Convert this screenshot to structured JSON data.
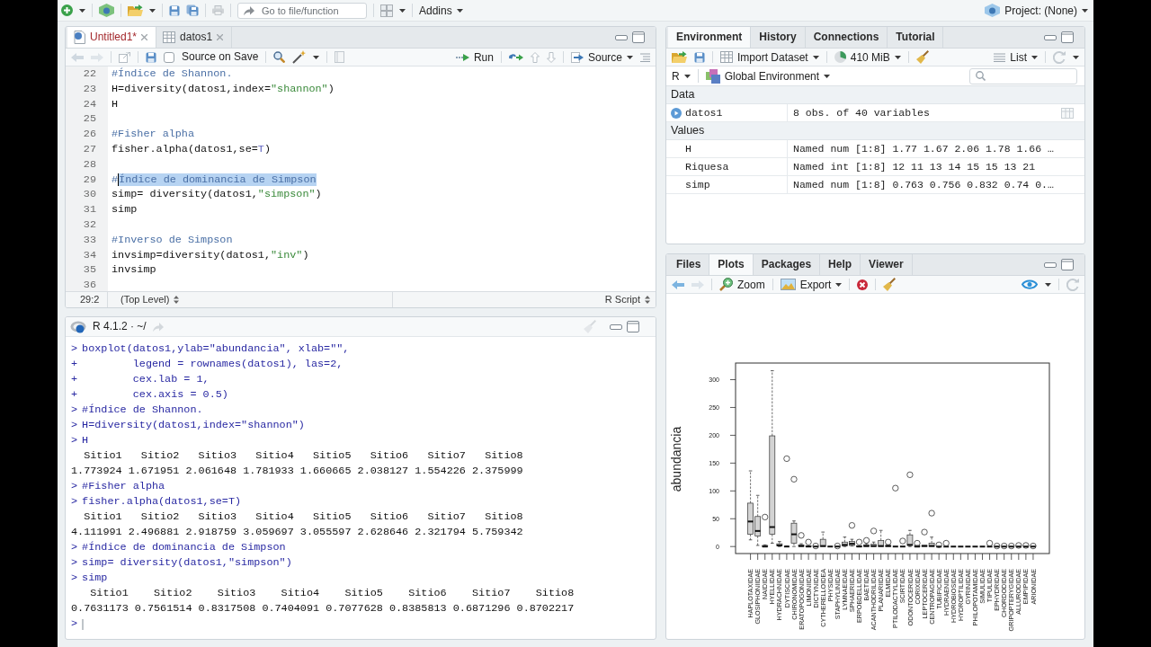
{
  "toolbar": {
    "go_to_placeholder": "Go to file/function",
    "addins": "Addins",
    "project": "Project: (None)"
  },
  "editor": {
    "tabs": [
      {
        "label": "Untitled1*",
        "kind": "script",
        "modified": true,
        "selected": true
      },
      {
        "label": "datos1",
        "kind": "data",
        "modified": false,
        "selected": false
      }
    ],
    "source_on_save": {
      "label": "Source on Save",
      "checked": false
    },
    "run": "Run",
    "source": "Source",
    "lines": [
      {
        "number": "22",
        "tokens": [
          {
            "kind": "comment",
            "text": "#Índice de Shannon.",
            "selected": false
          }
        ]
      },
      {
        "number": "23",
        "tokens": [
          {
            "kind": "code",
            "text": "H=diversity(datos1,index=",
            "selected": false
          },
          {
            "kind": "string",
            "text": "\"shannon\"",
            "selected": false
          },
          {
            "kind": "code",
            "text": ")",
            "selected": false
          }
        ]
      },
      {
        "number": "24",
        "tokens": [
          {
            "kind": "code",
            "text": "H",
            "selected": false
          }
        ]
      },
      {
        "number": "25"
      },
      {
        "number": "26",
        "tokens": [
          {
            "kind": "comment",
            "text": "#Fisher alpha",
            "selected": false
          }
        ]
      },
      {
        "number": "27",
        "tokens": [
          {
            "kind": "code",
            "text": "fisher.alpha(datos1,se=",
            "selected": false
          },
          {
            "kind": "constant",
            "text": "T",
            "selected": false
          },
          {
            "kind": "code",
            "text": ")",
            "selected": false
          }
        ]
      },
      {
        "number": "28"
      },
      {
        "number": "29",
        "tokens": [
          {
            "kind": "comment",
            "text": "#",
            "selected": false
          },
          {
            "kind": "comment",
            "text": "Índice de dominancia de Simpson",
            "selected": true
          }
        ]
      },
      {
        "number": "30",
        "tokens": [
          {
            "kind": "code",
            "text": "simp= diversity(datos1,",
            "selected": false
          },
          {
            "kind": "string",
            "text": "\"simpson\"",
            "selected": false
          },
          {
            "kind": "code",
            "text": ")",
            "selected": false
          }
        ]
      },
      {
        "number": "31",
        "tokens": [
          {
            "kind": "code",
            "text": "simp",
            "selected": false
          }
        ]
      },
      {
        "number": "32"
      },
      {
        "number": "33",
        "tokens": [
          {
            "kind": "comment",
            "text": "#Inverso de Simpson",
            "selected": false
          }
        ]
      },
      {
        "number": "34",
        "tokens": [
          {
            "kind": "code",
            "text": "invsimp=diversity(datos1,",
            "selected": false
          },
          {
            "kind": "string",
            "text": "\"inv\"",
            "selected": false
          },
          {
            "kind": "code",
            "text": ")",
            "selected": false
          }
        ]
      },
      {
        "number": "35",
        "tokens": [
          {
            "kind": "code",
            "text": "invsimp",
            "selected": false
          }
        ]
      },
      {
        "number": "36"
      }
    ],
    "status": {
      "position": "29:2",
      "scope": "(Top Level)",
      "file_type": "R Script"
    }
  },
  "console": {
    "title": "R 4.1.2 · ~/",
    "lines": [
      {
        "kind": "input",
        "prompt": ">",
        "text": "boxplot(datos1,ylab=\"abundancia\", xlab=\"\","
      },
      {
        "kind": "input",
        "prompt": "+",
        "text": "        legend = rownames(datos1), las=2,"
      },
      {
        "kind": "input",
        "prompt": "+",
        "text": "        cex.lab = 1,"
      },
      {
        "kind": "input",
        "prompt": "+",
        "text": "        cex.axis = 0.5)"
      },
      {
        "kind": "input",
        "prompt": ">",
        "text": "#Índice de Shannon."
      },
      {
        "kind": "input",
        "prompt": ">",
        "text": "H=diversity(datos1,index=\"shannon\")"
      },
      {
        "kind": "input",
        "prompt": ">",
        "text": "H"
      },
      {
        "kind": "output",
        "text": "  Sitio1   Sitio2   Sitio3   Sitio4   Sitio5   Sitio6   Sitio7   Sitio8"
      },
      {
        "kind": "output",
        "text": "1.773924 1.671951 2.061648 1.781933 1.660665 2.038127 1.554226 2.375999"
      },
      {
        "kind": "input",
        "prompt": ">",
        "text": "#Fisher alpha"
      },
      {
        "kind": "input",
        "prompt": ">",
        "text": "fisher.alpha(datos1,se=T)"
      },
      {
        "kind": "output",
        "text": "  Sitio1   Sitio2   Sitio3   Sitio4   Sitio5   Sitio6   Sitio7   Sitio8"
      },
      {
        "kind": "output",
        "text": "4.111991 2.496881 2.918759 3.059697 3.055597 2.628646 2.321794 5.759342"
      },
      {
        "kind": "input",
        "prompt": ">",
        "text": "#Índice de dominancia de Simpson"
      },
      {
        "kind": "input",
        "prompt": ">",
        "text": "simp= diversity(datos1,\"simpson\")"
      },
      {
        "kind": "input",
        "prompt": ">",
        "text": "simp"
      },
      {
        "kind": "output",
        "text": "   Sitio1    Sitio2    Sitio3    Sitio4    Sitio5    Sitio6    Sitio7    Sitio8"
      },
      {
        "kind": "output",
        "text": "0.7631173 0.7561514 0.8317508 0.7404091 0.7077628 0.8385813 0.6871296 0.8702217"
      },
      {
        "kind": "prompt",
        "prompt": ">"
      }
    ]
  },
  "environment": {
    "tabs": [
      {
        "label": "Environment",
        "selected": true
      },
      {
        "label": "History",
        "selected": false
      },
      {
        "label": "Connections",
        "selected": false
      },
      {
        "label": "Tutorial",
        "selected": false
      }
    ],
    "import": "Import Dataset",
    "memory": "410 MiB",
    "view": "List",
    "language": "R",
    "scope": "Global Environment",
    "sections": [
      {
        "title": "Data",
        "rows": [
          {
            "kind": "data",
            "name": "datos1",
            "value": "8 obs. of 40 variables"
          }
        ]
      },
      {
        "title": "Values",
        "rows": [
          {
            "kind": "value",
            "name": "H",
            "value": "Named num [1:8] 1.77 1.67 2.06 1.78 1.66 …"
          },
          {
            "kind": "value",
            "name": "Riquesa",
            "value": "Named int [1:8] 12 11 13 14 15 15 13 21"
          },
          {
            "kind": "value",
            "name": "simp",
            "value": "Named num [1:8] 0.763 0.756 0.832 0.74 0.…"
          }
        ]
      }
    ]
  },
  "files": {
    "tabs": [
      {
        "label": "Files",
        "selected": false
      },
      {
        "label": "Plots",
        "selected": true
      },
      {
        "label": "Packages",
        "selected": false
      },
      {
        "label": "Help",
        "selected": false
      },
      {
        "label": "Viewer",
        "selected": false
      }
    ],
    "zoom": "Zoom",
    "export": "Export",
    "plot": {
      "y_label": "abundancia",
      "y_ticks": [
        "300",
        "250",
        "200",
        "150",
        "100",
        "50",
        "0"
      ],
      "categories": [
        "HAPLOTAXIDAE",
        "GLOSIPHONIIDAE",
        "NAIDIDAE",
        "HYELLIDAE",
        "HYDRACHNIDAE",
        "DYTISCIDAE",
        "CHIRONOMIDAE",
        "ERATOPOGONIDAE",
        "LIMONIIDAE",
        "DICTYNIDAE",
        "CYTHERELLOIDEA",
        "PHYSIDAE",
        "STAPHYLINIDAE",
        "LYMNAEIDAE",
        "SPHAERIIDAE",
        "ERPOBDELLIDAE",
        "BAETIDAE",
        "ACANTHODRILIDAE",
        "PLANARIIDAE",
        "ELMIDAE",
        "PTILODACTYLIDAE",
        "SCIRTIDAE",
        "ODONTOCERIDAE",
        "CORIXIDAE",
        "LEPTOCERIDAE",
        "CENTROPAGIDAE",
        "TUBIFICIDAE",
        "HYDRAENIDAE",
        "HYDROBIOSIDAE",
        "HYDROPTILIDAE",
        "GYRINIDAE",
        "PHILOPOTAMIDAE",
        "SIMULIDAE",
        "TIPULIDAE",
        "EPHYDRIDAE",
        "CHORDODIDAE",
        "GRIPOPTERYGIDAE",
        "ALLURODIDAE",
        "EMPIPIDAE",
        "ARIONIDAE"
      ]
    }
  }
}
